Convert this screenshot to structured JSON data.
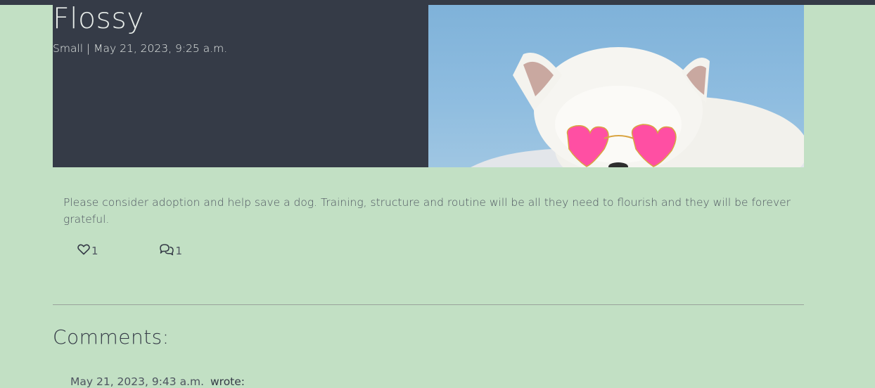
{
  "post": {
    "title": "Flossy",
    "subtitle": "Small | May 21, 2023, 9:25 a.m.",
    "image_alt": "White dog wearing pink heart-shaped sunglasses",
    "body": "Please consider adoption and help save a dog. Training, structure and routine will be all they need to flourish and they will be forever grateful.",
    "likes_count": "1",
    "comments_count": "1"
  },
  "comments": {
    "heading": "Comments:",
    "items": [
      {
        "timestamp": "May 21, 2023, 9:43 a.m.",
        "author": "wrote:"
      }
    ]
  },
  "icons": {
    "like": "heart-icon",
    "comment": "chat-bubbles-icon"
  },
  "colors": {
    "background": "#c2e0c4",
    "header": "#353b47",
    "header_text": "#e7ece9",
    "text": "#4e5560",
    "glasses_pink": "#ff4fa3"
  }
}
